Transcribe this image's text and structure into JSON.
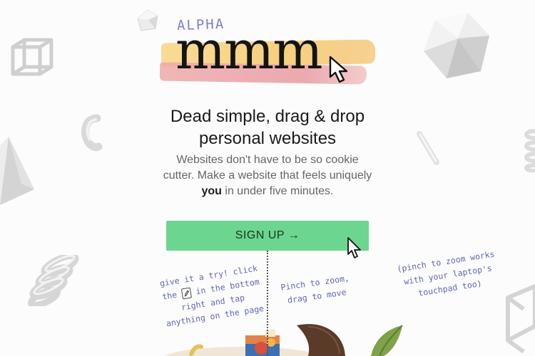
{
  "logo": {
    "alpha_label": "ALPHA",
    "wordmark": "mmm"
  },
  "hero": {
    "headline_line1": "Dead simple, drag & drop",
    "headline_line2": "personal websites",
    "subcopy_part1": "Websites don't have to be so cookie cutter. Make a website that feels uniquely ",
    "subcopy_emphasis": "you",
    "subcopy_part2": " in under five minutes."
  },
  "signup": {
    "label": "SIGN UP →"
  },
  "notes": {
    "left_part1": "give it a try! click the",
    "left_part2": "in the bottom right and tap anything on the page",
    "middle": "Pinch to zoom, drag to move",
    "right": "(pinch to zoom works with your laptop's touchpad too)"
  },
  "icons": {
    "logo_cursor": "arrow-cursor-icon",
    "signup_cursor": "arrow-cursor-icon",
    "edit": "pencil-icon"
  },
  "colors": {
    "accent_green": "#6cd58f",
    "handwriting": "#6166b8",
    "alpha": "#7d7fcf",
    "brush_yellow": "#f6cd78",
    "brush_pink": "#eaa0a5"
  }
}
